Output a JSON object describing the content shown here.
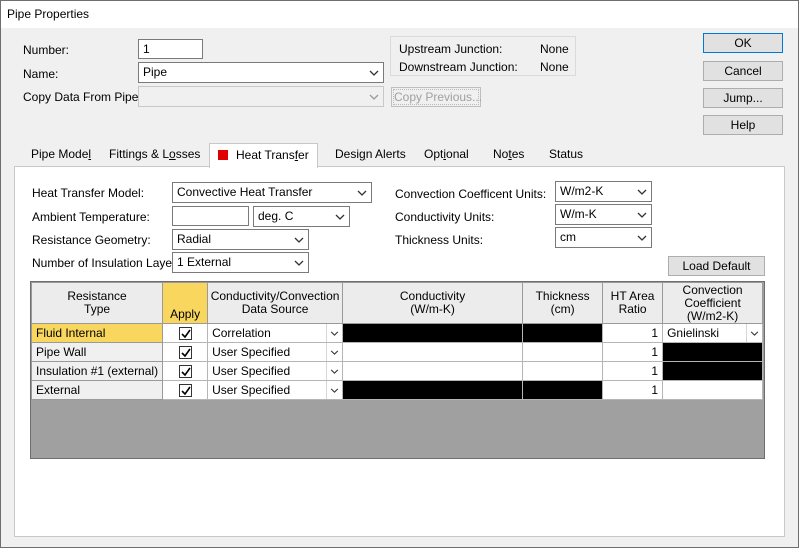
{
  "window": {
    "title": "Pipe Properties"
  },
  "form": {
    "number_label": "Number:",
    "number_value": "1",
    "name_label": "Name:",
    "name_value": "Pipe",
    "copy_label": "Copy Data From Pipe...",
    "copy_value": "",
    "copy_previous_button": "Copy Previous..."
  },
  "junctions": {
    "upstream_label": "Upstream Junction:",
    "upstream_value": "None",
    "downstream_label": "Downstream Junction:",
    "downstream_value": "None"
  },
  "buttons": {
    "ok": "OK",
    "cancel": "Cancel",
    "jump": "Jump...",
    "help": "Help"
  },
  "tabs": [
    {
      "pre": "Pipe Mode",
      "ul": "l",
      "post": ""
    },
    {
      "pre": "Fittings & L",
      "ul": "o",
      "post": "sses"
    },
    {
      "pre": "Heat Trans",
      "ul": "f",
      "post": "er"
    },
    {
      "pre": "Desi",
      "ul": "g",
      "post": "n Alerts"
    },
    {
      "pre": "Opt",
      "ul": "i",
      "post": "onal"
    },
    {
      "pre": "No",
      "ul": "t",
      "post": "es"
    },
    {
      "pre": "Status",
      "ul": "",
      "post": ""
    }
  ],
  "heat_transfer": {
    "model_label": "Heat Transfer Model:",
    "model_value": "Convective Heat Transfer",
    "ambient_label": "Ambient Temperature:",
    "ambient_value": "",
    "ambient_unit": "deg. C",
    "geometry_label": "Resistance Geometry:",
    "geometry_value": "Radial",
    "layers_label": "Number of Insulation Layers:",
    "layers_value": "1 External",
    "conv_units_label": "Convection Coefficent Units:",
    "conv_units_value": "W/m2-K",
    "cond_units_label": "Conductivity Units:",
    "cond_units_value": "W/m-K",
    "thick_units_label": "Thickness Units:",
    "thick_units_value": "cm",
    "load_default_button": "Load Default"
  },
  "grid": {
    "headers": {
      "type": [
        "Resistance",
        "Type"
      ],
      "apply": "Apply",
      "source": [
        "Conductivity/Convection",
        "Data Source"
      ],
      "conductivity": [
        "Conductivity",
        "(W/m-K)"
      ],
      "thickness": [
        "Thickness",
        "(cm)"
      ],
      "ratio": [
        "HT Area",
        "Ratio"
      ],
      "coef": [
        "Convection",
        "Coefficient",
        "(W/m2-K)"
      ]
    },
    "rows": [
      {
        "type": "Fluid Internal",
        "source": "Correlation",
        "ratio": "1",
        "coef": "Gnielinski"
      },
      {
        "type": "Pipe Wall",
        "source": "User Specified",
        "ratio": "1",
        "coef": ""
      },
      {
        "type": "Insulation #1 (external)",
        "source": "User Specified",
        "ratio": "1",
        "coef": ""
      },
      {
        "type": "External",
        "source": "User Specified",
        "ratio": "1",
        "coef": ""
      }
    ]
  }
}
